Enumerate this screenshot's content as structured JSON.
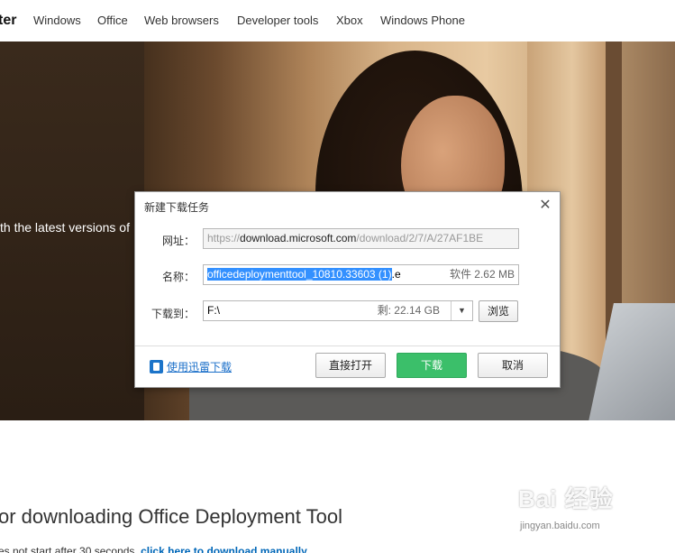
{
  "nav": {
    "brand": "ter",
    "links": [
      "Windows",
      "Office",
      "Web browsers",
      "Developer tools",
      "Xbox",
      "Windows Phone"
    ]
  },
  "hero": {
    "text": "th the latest versions of"
  },
  "main": {
    "heading": "or downloading Office Deployment Tool",
    "subline_prefix": "es not start after 30 seconds, ",
    "subline_link": "click here to download manually"
  },
  "dialog": {
    "title": "新建下载任务",
    "url_label": "网址：",
    "url_scheme": "https://",
    "url_domain": "download.microsoft.com",
    "url_path": "/download/2/7/A/27AF1BE",
    "name_label": "名称：",
    "name_selected": "officedeploymenttool_10810.33603 (1)",
    "name_rest": ".e",
    "size_text": "软件 2.62 MB",
    "path_label": "下载到：",
    "path_value": "F:\\",
    "free_text": "剩: 22.14 GB",
    "browse_label": "浏览",
    "xunlei_link": "使用迅雷下载",
    "open_label": "直接打开",
    "download_label": "下载",
    "cancel_label": "取消"
  },
  "watermark": {
    "main": "Bai 经验",
    "sub": "jingyan.baidu.com"
  },
  "colors": {
    "download_button": "#3bbf6a",
    "selection": "#3390ff",
    "link": "#1a6fc9"
  }
}
